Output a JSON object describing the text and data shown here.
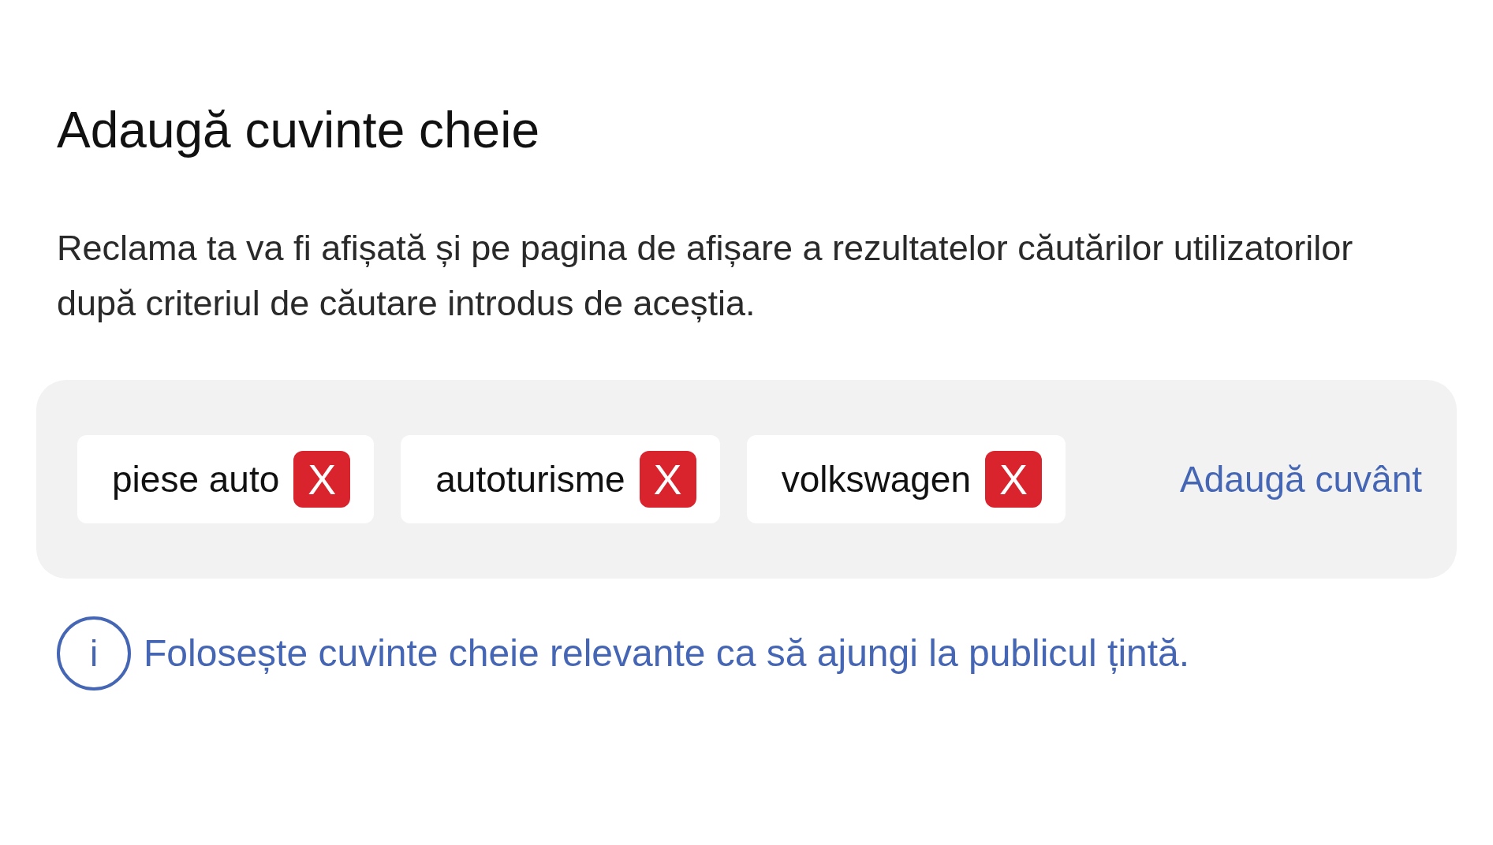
{
  "title": "Adaugă cuvinte cheie",
  "description": "Reclama ta va fi afișată și pe pagina de afișare a rezultatelor căutărilor utilizatorilor după criteriul de căutare introdus de aceștia.",
  "keywords": [
    {
      "label": "piese auto",
      "remove": "X"
    },
    {
      "label": "autoturisme",
      "remove": "X"
    },
    {
      "label": "volkswagen",
      "remove": "X"
    }
  ],
  "add_link": "Adaugă cuvânt",
  "info": {
    "icon": "i",
    "text": "Folosește cuvinte cheie relevante ca să ajungi la publicul țintă."
  }
}
